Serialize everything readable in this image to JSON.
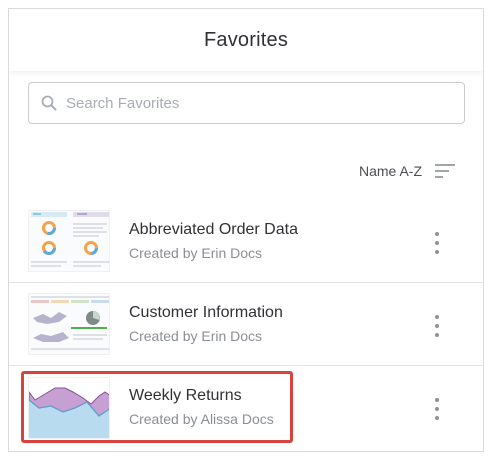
{
  "header": {
    "title": "Favorites"
  },
  "search": {
    "placeholder": "Search Favorites",
    "value": ""
  },
  "sort": {
    "label": "Name A-Z"
  },
  "items": [
    {
      "title": "Abbreviated Order Data",
      "subtitle": "Created by Erin Docs",
      "thumbnail": "dashboard-donuts"
    },
    {
      "title": "Customer Information",
      "subtitle": "Created by Erin Docs",
      "thumbnail": "dashboard-map"
    },
    {
      "title": "Weekly Returns",
      "subtitle": "Created by Alissa Docs",
      "thumbnail": "area-chart",
      "highlighted": true
    }
  ],
  "colors": {
    "highlight": "#d9433f",
    "text_primary": "#2f3134",
    "text_secondary": "#8a8e95",
    "area_fill": "#b9dbef",
    "area_accent": "#c7a0d3"
  }
}
